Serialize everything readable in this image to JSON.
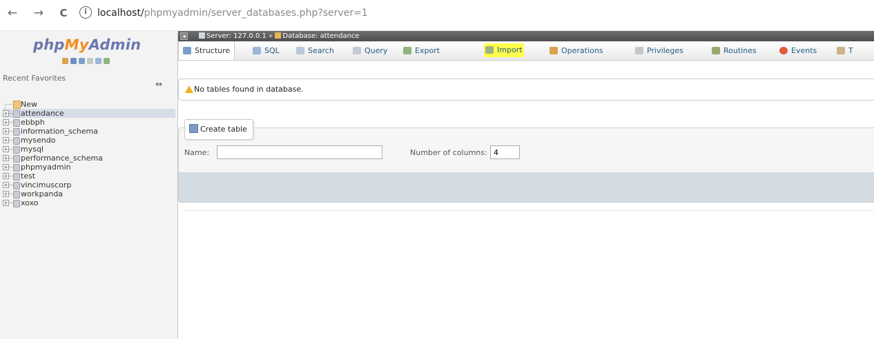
{
  "browser": {
    "back_icon": "←",
    "forward_icon": "→",
    "reload_icon": "C",
    "info_icon": "i",
    "url_host": "localhost/",
    "url_path": "phpmyadmin/server_databases.php?server=1"
  },
  "logo": {
    "php": "php",
    "my": "My",
    "admin": "Admin"
  },
  "nav": {
    "recent_favorites": "Recent  Favorites",
    "collapse_icon": "⇔",
    "new_label": "New",
    "databases": [
      "attendance",
      "ebbph",
      "information_schema",
      "mysendo",
      "mysql",
      "performance_schema",
      "phpmyadmin",
      "test",
      "vincimuscorp",
      "workpanda",
      "xoxo"
    ],
    "selected_database": "attendance"
  },
  "breadcrumb": {
    "server": "Server: 127.0.0.1",
    "separator": "»",
    "database": "Database: attendance"
  },
  "tabs": [
    {
      "label": "Structure",
      "icon_color": "#7aa0c9"
    },
    {
      "label": "SQL",
      "icon_color": "#9bb6d6"
    },
    {
      "label": "Search",
      "icon_color": "#b8c6d9"
    },
    {
      "label": "Query",
      "icon_color": "#c4cbd6"
    },
    {
      "label": "Export",
      "icon_color": "#8fb37e"
    },
    {
      "label": "Import",
      "icon_color": "#9fb37e"
    },
    {
      "label": "Operations",
      "icon_color": "#d9a24e"
    },
    {
      "label": "Privileges",
      "icon_color": "#c7c7c7"
    },
    {
      "label": "Routines",
      "icon_color": "#9aaa6e"
    },
    {
      "label": "Events",
      "icon_color": "#e05a3a"
    },
    {
      "label": "T",
      "icon_color": "#c9b38a"
    }
  ],
  "notice": {
    "text": "No tables found in database."
  },
  "create_table": {
    "legend": "Create table",
    "name_label": "Name:",
    "name_value": "",
    "columns_label": "Number of columns:",
    "columns_value": "4"
  }
}
